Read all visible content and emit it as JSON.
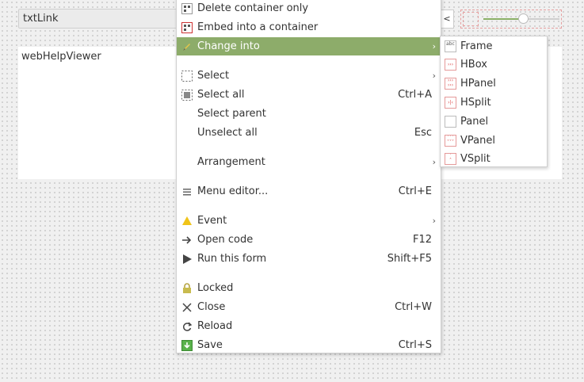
{
  "form": {
    "txtlink_text": "txtLink",
    "webhelp_text": "webHelpViewer",
    "lt_button": "<",
    "slider_value": 0.53
  },
  "menu": {
    "items": [
      {
        "label": "Delete container only",
        "icon": "delete-container-icon"
      },
      {
        "label": "Embed into a container",
        "icon": "embed-container-icon"
      },
      {
        "label": "Change into",
        "icon": "pencil-icon",
        "arrow": "›"
      },
      {
        "label": "Select",
        "icon": "select-icon",
        "arrow": "›"
      },
      {
        "label": "Select all",
        "icon": "select-all-icon",
        "shortcut": "Ctrl+A"
      },
      {
        "label": "Select parent"
      },
      {
        "label": "Unselect all",
        "shortcut": "Esc"
      },
      {
        "label": "Arrangement",
        "arrow": "›"
      },
      {
        "label": "Menu editor...",
        "icon": "menu-icon",
        "shortcut": "Ctrl+E"
      },
      {
        "label": "Event",
        "icon": "event-triangle-icon",
        "arrow": "›"
      },
      {
        "label": "Open code",
        "icon": "arrow-right-icon",
        "shortcut": "F12"
      },
      {
        "label": "Run this form",
        "icon": "play-icon",
        "shortcut": "Shift+F5"
      },
      {
        "label": "Locked",
        "icon": "lock-icon"
      },
      {
        "label": "Close",
        "icon": "close-icon",
        "shortcut": "Ctrl+W"
      },
      {
        "label": "Reload",
        "icon": "reload-icon"
      },
      {
        "label": "Save",
        "icon": "save-icon",
        "shortcut": "Ctrl+S"
      }
    ]
  },
  "submenu": {
    "items": [
      {
        "label": "Frame",
        "icon": "frame-icon"
      },
      {
        "label": "HBox",
        "icon": "hbox-icon"
      },
      {
        "label": "HPanel",
        "icon": "hpanel-icon"
      },
      {
        "label": "HSplit",
        "icon": "hsplit-icon"
      },
      {
        "label": "Panel",
        "icon": "panel-icon"
      },
      {
        "label": "VPanel",
        "icon": "vpanel-icon"
      },
      {
        "label": "VSplit",
        "icon": "vsplit-icon"
      }
    ]
  },
  "colors": {
    "highlight": "#8dac6a",
    "slider": "#8bb068"
  }
}
